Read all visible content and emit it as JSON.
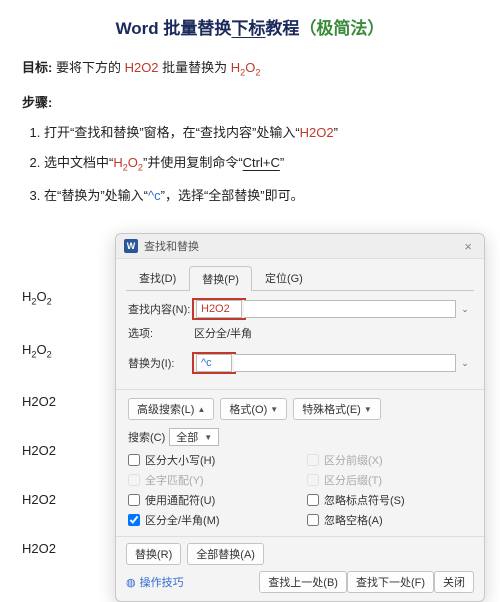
{
  "title": {
    "prefix": "Word 批量替换",
    "underlined": "下标",
    "suffix": "教程",
    "paren_open": "（",
    "method": "极简法",
    "paren_close": "）"
  },
  "goal": {
    "label": "目标:",
    "before": " 要将下方的 ",
    "from": "H2O2",
    "mid": " 批量替换为 ",
    "to_h": "H",
    "to_2a": "2",
    "to_o": "O",
    "to_2b": "2"
  },
  "steps_label": "步骤:",
  "steps": {
    "s1a": "打开“查找和替换”窗格，在“查找内容”处输入“",
    "s1b": "H2O2",
    "s1c": "”",
    "s2a": "选中文档中“",
    "s2h": "H",
    "s2_2a": "2",
    "s2o": "O",
    "s2_2b": "2",
    "s2b": "”并使用复制命令“",
    "s2cmd": "Ctrl+C",
    "s2c": "”",
    "s3a": "在“替换为”处输入“",
    "s3code": "^c",
    "s3b": "”，选择“全部替换”即可。"
  },
  "samples": {
    "h": "H",
    "o": "O",
    "two": "2",
    "plain": "H2O2"
  },
  "dialog": {
    "title": "查找和替换",
    "close": "×",
    "tabs": {
      "find": "查找(D)",
      "replace": "替换(P)",
      "goto": "定位(G)"
    },
    "find_label": "查找内容(N):",
    "find_value": "H2O2",
    "options_label": "选项:",
    "options_value": "区分全/半角",
    "replace_label": "替换为(I):",
    "replace_value": "^c",
    "adv_search": "高级搜索(L)",
    "format_btn": "格式(O)",
    "special_btn": "特殊格式(E)",
    "scope_label": "搜索(C)",
    "scope_value": "全部",
    "checks": {
      "case": "区分大小写(H)",
      "prefix": "区分前缀(X)",
      "whole": "全字匹配(Y)",
      "suffix": "区分后缀(T)",
      "wildcard": "使用通配符(U)",
      "ignore_punc": "忽略标点符号(S)",
      "fullhalf": "区分全/半角(M)",
      "ignore_space": "忽略空格(A)"
    },
    "replace_btn": "替换(R)",
    "replace_all_btn": "全部替换(A)",
    "tips": "操作技巧",
    "find_prev": "查找上一处(B)",
    "find_next": "查找下一处(F)",
    "close_btn": "关闭"
  }
}
